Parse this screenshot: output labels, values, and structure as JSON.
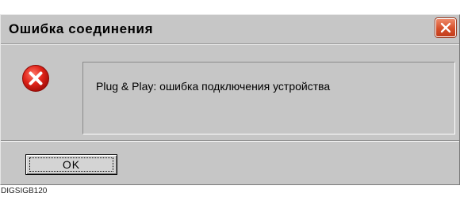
{
  "dialog": {
    "title": "Ошибка соединения",
    "message": "Plug & Play: ошибка подключения устройства",
    "ok_label": "OK",
    "icon": "error-icon",
    "close_icon": "close-icon"
  },
  "caption": "DIGSIGB120",
  "colors": {
    "window_bg": "#c6c6c6",
    "close_button": "#d6502a",
    "error_icon": "#e0241a"
  }
}
